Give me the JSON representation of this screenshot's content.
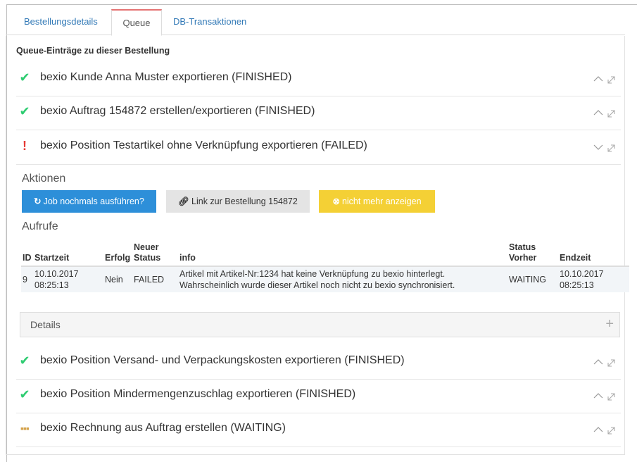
{
  "tabs": [
    {
      "label": "Bestellungsdetails"
    },
    {
      "label": "Queue"
    },
    {
      "label": "DB-Transaktionen"
    }
  ],
  "heading": "Queue-Einträge zu dieser Bestellung",
  "queue": [
    {
      "status": "finished",
      "title": "bexio Kunde Anna Muster exportieren (FINISHED)"
    },
    {
      "status": "finished",
      "title": "bexio Auftrag 154872 erstellen/exportieren (FINISHED)"
    },
    {
      "status": "failed",
      "title": "bexio Position Testartikel ohne Verknüpfung exportieren (FAILED)"
    },
    {
      "status": "finished",
      "title": "bexio Position Versand- und Verpackungskosten exportieren (FINISHED)"
    },
    {
      "status": "finished",
      "title": "bexio Position Mindermengenzuschlag exportieren (FINISHED)"
    },
    {
      "status": "waiting",
      "title": "bexio Rechnung aus Auftrag erstellen (WAITING)"
    }
  ],
  "expanded": {
    "actions_label": "Aktionen",
    "buttons": {
      "retry": "Job nochmals ausführen?",
      "link": "Link zur Bestellung 154872",
      "hide": "nicht mehr anzeigen"
    },
    "calls_label": "Aufrufe",
    "table": {
      "headers": {
        "id": "ID",
        "start": "Startzeit",
        "success": "Erfolg",
        "new_status_1": "Neuer",
        "new_status_2": "Status",
        "info": "info",
        "prev_status_1": "Status",
        "prev_status_2": "Vorher",
        "end": "Endzeit"
      },
      "row": {
        "id": "9",
        "start_date": "10.10.2017",
        "start_time": "08:25:13",
        "success": "Nein",
        "new_status": "FAILED",
        "info_1": "Artikel mit Artikel-Nr:1234 hat keine Verknüpfung zu bexio hinterlegt.",
        "info_2": "Wahrscheinlich wurde dieser Artikel noch nicht zu bexio synchronisiert.",
        "prev_status": "WAITING",
        "end_date": "10.10.2017",
        "end_time": "08:25:13"
      }
    },
    "details_label": "Details",
    "details_toggle": "+"
  },
  "icons": {
    "finished": "check-icon",
    "failed": "exclamation-icon",
    "waiting": "dots-icon",
    "collapse": "chevron-up-icon",
    "expand": "chevron-down-icon",
    "popout": "expand-arrow-icon"
  },
  "colors": {
    "finished": "#2ecc71",
    "failed": "#e53935",
    "waiting": "#d4a24a",
    "primary": "#2d8fd9",
    "warning": "#f4d035",
    "active_tab_accent": "#e57373"
  }
}
